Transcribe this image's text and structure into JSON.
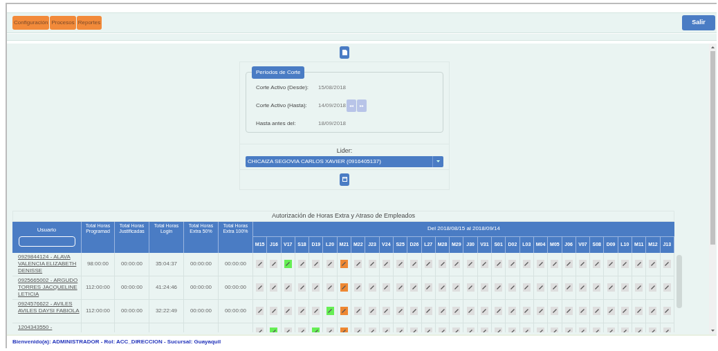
{
  "menu": [
    {
      "label": "Configuración"
    },
    {
      "label": "Procesos"
    },
    {
      "label": "Reportes"
    }
  ],
  "logout": "Salir",
  "periods": {
    "title": "Periodos de Corte",
    "rows": [
      {
        "kind": "date",
        "label": "Corte Activo (Desde):",
        "value": "15/08/2018"
      },
      {
        "kind": "nav",
        "label": "Corte Activo (Hasta):",
        "value": "14/09/2018"
      },
      {
        "kind": "date",
        "label": "Hasta antes del:",
        "value": "18/09/2018"
      }
    ]
  },
  "leader": {
    "label": "Lider:",
    "value": "CHICAIZA SEGOVIA CARLOS XAVIER (0916405137)"
  },
  "table": {
    "title": "Autorización de Horas Extra y Atraso de Empleados",
    "user_column": "Usuario",
    "columns": [
      "Total Horas Programad",
      "Total Horas Justificadas",
      "Total Horas Login",
      "Total Horas Extra 50%",
      "Total Horas Extra 100%"
    ],
    "period_label": "Del 2018/08/15 al 2018/09/14",
    "days": [
      "M15",
      "J16",
      "V17",
      "S18",
      "D19",
      "L20",
      "M21",
      "M22",
      "J23",
      "V24",
      "S25",
      "D26",
      "L27",
      "M28",
      "M29",
      "J30",
      "V31",
      "S01",
      "D02",
      "L03",
      "M04",
      "M05",
      "J06",
      "V07",
      "S08",
      "D09",
      "L10",
      "M11",
      "M12",
      "J13"
    ],
    "rows": [
      {
        "user": "0929844124 - ALAVA VALENCIA ELIZABETH DENISSE",
        "values": [
          "98:00:00",
          "00:00:00",
          "35:04:37",
          "00:00:00",
          "00:00:00"
        ],
        "cells": [
          {
            "color": "#dedede"
          },
          {
            "color": "#dedede"
          },
          {
            "color": "#66ee55"
          },
          {
            "color": "#dedede"
          },
          {
            "color": "#dedede"
          },
          {
            "color": "#dedede"
          },
          {
            "color": "#ee8833"
          },
          {
            "color": "#dedede"
          },
          {
            "color": "#dedede"
          },
          {
            "color": "#dedede"
          },
          {
            "color": "#dedede"
          },
          {
            "color": "#dedede"
          },
          {
            "color": "#dedede"
          },
          {
            "color": "#dedede"
          },
          {
            "color": "#dedede"
          },
          {
            "color": "#dedede"
          },
          {
            "color": "#dedede"
          },
          {
            "color": "#dedede"
          },
          {
            "color": "#dedede"
          },
          {
            "color": "#dedede"
          },
          {
            "color": "#dedede"
          },
          {
            "color": "#dedede"
          },
          {
            "color": "#dedede"
          },
          {
            "color": "#dedede"
          },
          {
            "color": "#dedede"
          },
          {
            "color": "#dedede"
          },
          {
            "color": "#dedede"
          },
          {
            "color": "#dedede"
          },
          {
            "color": "#dedede"
          },
          {
            "color": "#dedede"
          }
        ]
      },
      {
        "user": "0925665002 - ARGUDO TORRES JACQUELINE LETICIA",
        "values": [
          "112:00:00",
          "00:00:00",
          "41:24:46",
          "00:00:00",
          "00:00:00"
        ],
        "cells": [
          {
            "color": "#dedede"
          },
          {
            "color": "#dedede"
          },
          {
            "color": "#dedede"
          },
          {
            "color": "#dedede"
          },
          {
            "color": "#dedede"
          },
          {
            "color": "#dedede"
          },
          {
            "color": "#ee8833"
          },
          {
            "color": "#dedede"
          },
          {
            "color": "#dedede"
          },
          {
            "color": "#dedede"
          },
          {
            "color": "#dedede"
          },
          {
            "color": "#dedede"
          },
          {
            "color": "#dedede"
          },
          {
            "color": "#dedede"
          },
          {
            "color": "#dedede"
          },
          {
            "color": "#dedede"
          },
          {
            "color": "#dedede"
          },
          {
            "color": "#dedede"
          },
          {
            "color": "#dedede"
          },
          {
            "color": "#dedede"
          },
          {
            "color": "#dedede"
          },
          {
            "color": "#dedede"
          },
          {
            "color": "#dedede"
          },
          {
            "color": "#dedede"
          },
          {
            "color": "#dedede"
          },
          {
            "color": "#dedede"
          },
          {
            "color": "#dedede"
          },
          {
            "color": "#dedede"
          },
          {
            "color": "#dedede"
          },
          {
            "color": "#dedede"
          }
        ]
      },
      {
        "user": "0924576622 - AVILES AVILES DAYSI FABIOLA",
        "values": [
          "112:00:00",
          "00:00:00",
          "32:22:49",
          "00:00:00",
          "00:00:00"
        ],
        "cells": [
          {
            "color": "#dedede"
          },
          {
            "color": "#dedede"
          },
          {
            "color": "#dedede"
          },
          {
            "color": "#dedede"
          },
          {
            "color": "#dedede"
          },
          {
            "color": "#66ee55"
          },
          {
            "color": "#ee8833"
          },
          {
            "color": "#dedede"
          },
          {
            "color": "#dedede"
          },
          {
            "color": "#dedede"
          },
          {
            "color": "#dedede"
          },
          {
            "color": "#dedede"
          },
          {
            "color": "#dedede"
          },
          {
            "color": "#dedede"
          },
          {
            "color": "#dedede"
          },
          {
            "color": "#dedede"
          },
          {
            "color": "#dedede"
          },
          {
            "color": "#dedede"
          },
          {
            "color": "#dedede"
          },
          {
            "color": "#dedede"
          },
          {
            "color": "#dedede"
          },
          {
            "color": "#dedede"
          },
          {
            "color": "#dedede"
          },
          {
            "color": "#dedede"
          },
          {
            "color": "#dedede"
          },
          {
            "color": "#dedede"
          },
          {
            "color": "#dedede"
          },
          {
            "color": "#dedede"
          },
          {
            "color": "#dedede"
          },
          {
            "color": "#dedede"
          }
        ]
      },
      {
        "user": "1204343550 -",
        "cells": [
          {
            "color": "#dedede"
          },
          {
            "color": "#66ee55"
          },
          {
            "color": "#dedede"
          },
          {
            "color": "#dedede"
          },
          {
            "color": "#66ee55"
          },
          {
            "color": "#dedede"
          },
          {
            "color": "#ee8833"
          },
          {
            "color": "#dedede"
          },
          {
            "color": "#dedede"
          },
          {
            "color": "#dedede"
          },
          {
            "color": "#dedede"
          },
          {
            "color": "#dedede"
          },
          {
            "color": "#dedede"
          },
          {
            "color": "#dedede"
          },
          {
            "color": "#dedede"
          },
          {
            "color": "#dedede"
          },
          {
            "color": "#dedede"
          },
          {
            "color": "#dedede"
          },
          {
            "color": "#dedede"
          },
          {
            "color": "#dedede"
          },
          {
            "color": "#dedede"
          },
          {
            "color": "#dedede"
          },
          {
            "color": "#dedede"
          },
          {
            "color": "#dedede"
          },
          {
            "color": "#dedede"
          },
          {
            "color": "#dedede"
          },
          {
            "color": "#dedede"
          },
          {
            "color": "#dedede"
          },
          {
            "color": "#dedede"
          },
          {
            "color": "#dedede"
          }
        ]
      }
    ]
  },
  "status_bar": "Bienvenido(a): ADMINISTRADOR - Rol: ACC_DIRECCION - Sucursal: Guayaquil"
}
